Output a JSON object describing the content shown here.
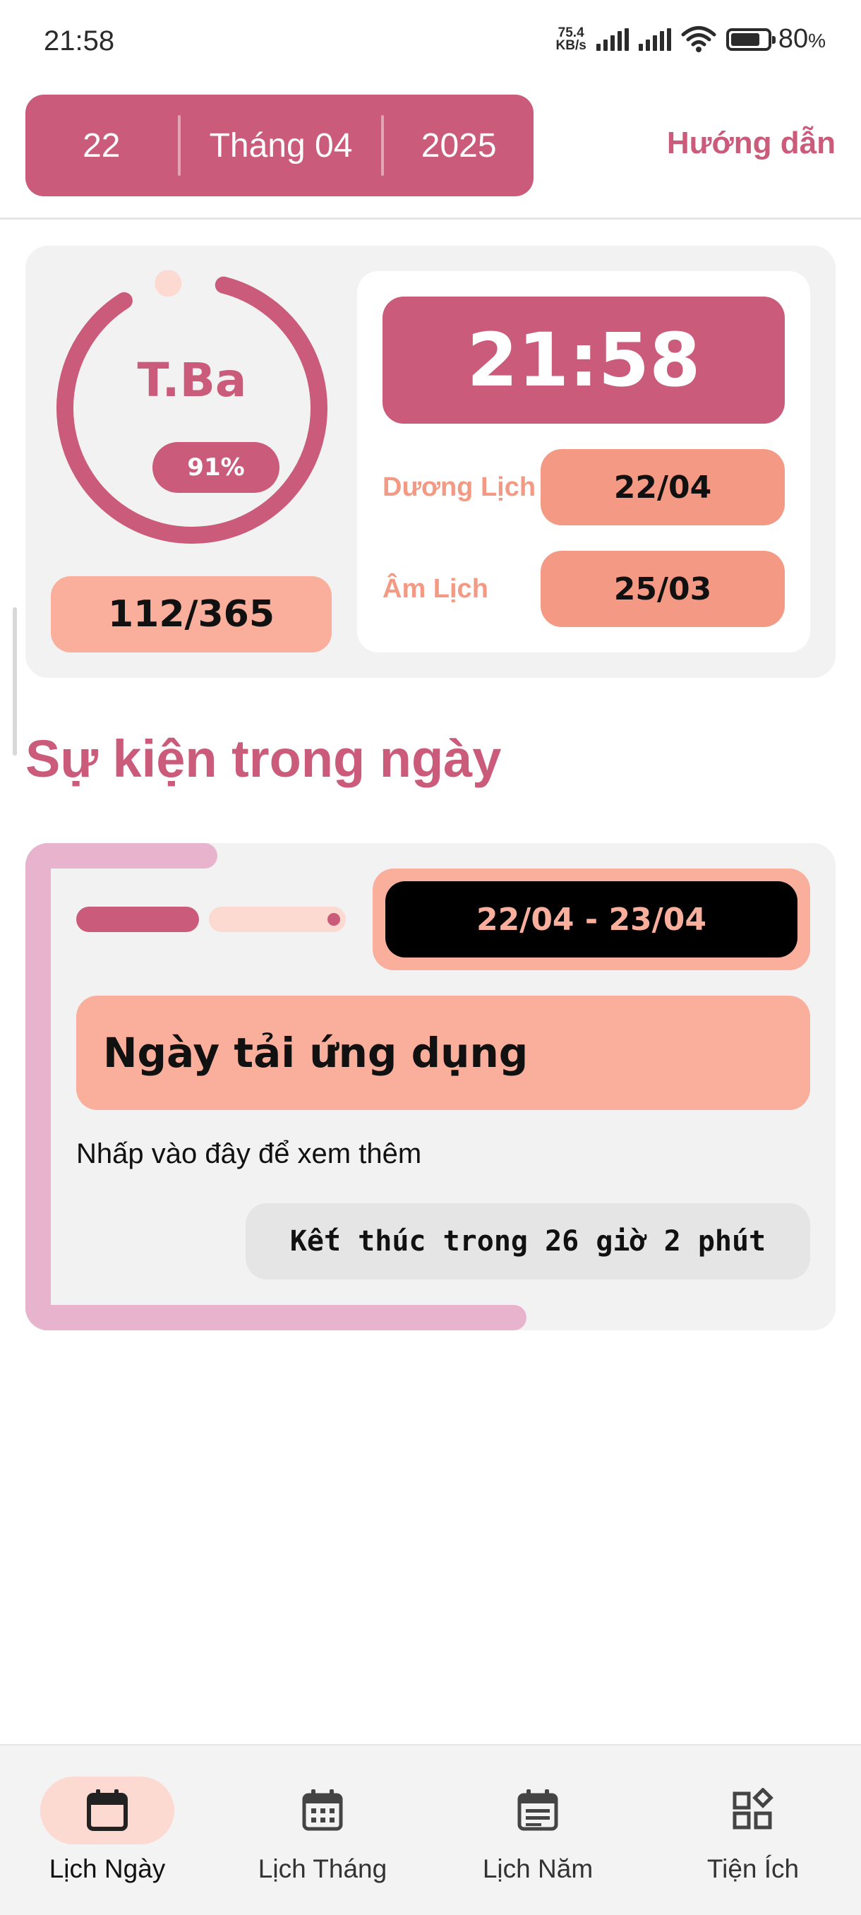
{
  "status_bar": {
    "time": "21:58",
    "net_speed_value": "75.4",
    "net_speed_unit": "KB/s",
    "battery_percent": "80",
    "battery_unit": "%",
    "battery_level": 0.8
  },
  "header": {
    "day": "22",
    "month": "Tháng 04",
    "year": "2025",
    "guide_label": "Hướng dẫn"
  },
  "overview": {
    "weekday": "T.Ba",
    "day_progress_label": "91%",
    "day_progress": 0.91,
    "day_of_year": "112/365",
    "clock": "21:58",
    "solar_label": "Dương Lịch",
    "solar_date": "22/04",
    "lunar_label": "Âm Lịch",
    "lunar_date": "25/03"
  },
  "events": {
    "section_title": "Sự kiện trong ngày",
    "items": [
      {
        "date_range": "22/04 - 23/04",
        "title": "Ngày tải ứng dụng",
        "hint": "Nhấp vào đây để xem thêm",
        "remaining": "Kết thúc trong 26 giờ 2 phút"
      }
    ]
  },
  "bottom_nav": {
    "items": [
      {
        "label": "Lịch Ngày",
        "icon": "calendar-icon",
        "active": true
      },
      {
        "label": "Lịch Tháng",
        "icon": "calendar-month-icon",
        "active": false
      },
      {
        "label": "Lịch Năm",
        "icon": "calendar-year-icon",
        "active": false
      },
      {
        "label": "Tiện Ích",
        "icon": "widgets-icon",
        "active": false
      }
    ]
  },
  "colors": {
    "primary": "#cb5b7a",
    "accent_salmon": "#faaf9c",
    "accent_coral": "#f49a84",
    "accent_pink_light": "#e8b4cd",
    "card_bg": "#f2f2f2",
    "active_nav_bg": "#fcd9d1"
  }
}
